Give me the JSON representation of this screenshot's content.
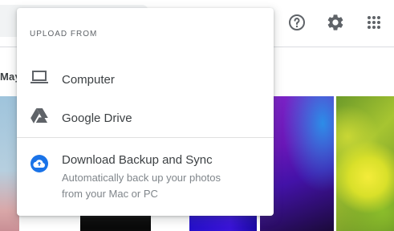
{
  "background": {
    "date_header": "May"
  },
  "header_icons": [
    {
      "icon": "help-circle-icon",
      "label": "?"
    },
    {
      "icon": "gear-icon"
    },
    {
      "icon": "apps-grid-icon"
    }
  ],
  "upload_menu": {
    "heading": "UPLOAD FROM",
    "items": [
      {
        "label": "Computer",
        "icon": "laptop-icon"
      },
      {
        "label": "Google Drive",
        "icon": "google-drive-icon"
      },
      {
        "label": "Download Backup and Sync",
        "icon": "cloud-upload-icon",
        "description_lines": [
          "Automatically back up your photos",
          "from your Mac or PC"
        ]
      }
    ]
  },
  "colors": {
    "icon_gray": "#5f6368",
    "accent_blue": "#1a73e8",
    "text_primary": "#3c4043",
    "text_secondary": "#80868b"
  }
}
